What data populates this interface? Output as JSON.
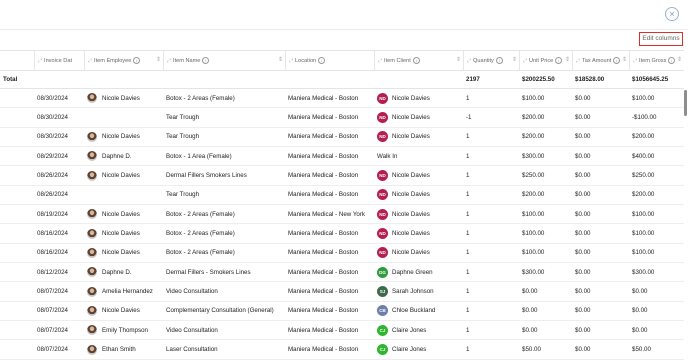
{
  "header": {
    "close_icon": "×",
    "edit_columns_label": "Edit columns"
  },
  "columns": [
    {
      "label": "",
      "sortable": false
    },
    {
      "label": "Invoice Dat",
      "sortable": false
    },
    {
      "label": "Item Employee",
      "sortable": true,
      "info": true
    },
    {
      "label": "Item Name",
      "sortable": true,
      "info": true
    },
    {
      "label": "Location",
      "sortable": false,
      "info": true
    },
    {
      "label": "Item Client",
      "sortable": true,
      "info": true
    },
    {
      "label": "Quantity",
      "sortable": true,
      "info": true
    },
    {
      "label": "Unit Price",
      "sortable": true,
      "info": true
    },
    {
      "label": "Tax Amount",
      "sortable": true,
      "info": true
    },
    {
      "label": "Item Gross",
      "sortable": true,
      "info": true
    }
  ],
  "total_row": {
    "label": "Total",
    "quantity": "2197",
    "unit_price": "$200225.50",
    "tax_amount": "$18528.00",
    "item_gross": "$1056645.25"
  },
  "rows": [
    {
      "date": "08/30/2024",
      "employee": "Nicole Davies",
      "employee_avatar": true,
      "item": "Botox - 2 Areas (Female)",
      "location": "Maniera Medical - Boston",
      "client": "Nicole Davies",
      "client_initials": "ND",
      "client_color": "#b51f4f",
      "qty": "1",
      "unit": "$100.00",
      "tax": "$0.00",
      "gross": "$100.00"
    },
    {
      "date": "08/30/2024",
      "employee": "",
      "employee_avatar": false,
      "item": "Tear Trough",
      "location": "Maniera Medical - Boston",
      "client": "Nicole Davies",
      "client_initials": "ND",
      "client_color": "#b51f4f",
      "qty": "-1",
      "unit": "$200.00",
      "tax": "$0.00",
      "gross": "-$100.00"
    },
    {
      "date": "08/30/2024",
      "employee": "Nicole Davies",
      "employee_avatar": true,
      "item": "Tear Trough",
      "location": "Maniera Medical - Boston",
      "client": "Nicole Davies",
      "client_initials": "ND",
      "client_color": "#b51f4f",
      "qty": "1",
      "unit": "$200.00",
      "tax": "$0.00",
      "gross": "$200.00"
    },
    {
      "date": "08/29/2024",
      "employee": "Daphne D.",
      "employee_avatar": true,
      "item": "Botox - 1 Area (Female)",
      "location": "Maniera Medical - Boston",
      "client": "Walk In",
      "client_initials": "",
      "client_color": "",
      "qty": "1",
      "unit": "$300.00",
      "tax": "$0.00",
      "gross": "$400.00"
    },
    {
      "date": "08/26/2024",
      "employee": "Nicole Davies",
      "employee_avatar": true,
      "item": "Dermal Fillers Smokers Lines",
      "location": "Maniera Medical - Boston",
      "client": "Nicole Davies",
      "client_initials": "ND",
      "client_color": "#b51f4f",
      "qty": "1",
      "unit": "$250.00",
      "tax": "$0.00",
      "gross": "$250.00"
    },
    {
      "date": "08/26/2024",
      "employee": "",
      "employee_avatar": false,
      "item": "Tear Trough",
      "location": "Maniera Medical - Boston",
      "client": "Nicole Davies",
      "client_initials": "ND",
      "client_color": "#b51f4f",
      "qty": "1",
      "unit": "$200.00",
      "tax": "$0.00",
      "gross": "$200.00"
    },
    {
      "date": "08/19/2024",
      "employee": "Nicole Davies",
      "employee_avatar": true,
      "item": "Botox - 2 Areas (Female)",
      "location": "Maniera Medical - New York",
      "client": "Nicole Davies",
      "client_initials": "ND",
      "client_color": "#b51f4f",
      "qty": "1",
      "unit": "$100.00",
      "tax": "$0.00",
      "gross": "$100.00"
    },
    {
      "date": "08/16/2024",
      "employee": "Nicole Davies",
      "employee_avatar": true,
      "item": "Botox - 2 Areas (Female)",
      "location": "Maniera Medical - Boston",
      "client": "Nicole Davies",
      "client_initials": "ND",
      "client_color": "#b51f4f",
      "qty": "1",
      "unit": "$100.00",
      "tax": "$0.00",
      "gross": "$100.00"
    },
    {
      "date": "08/16/2024",
      "employee": "Nicole Davies",
      "employee_avatar": true,
      "item": "Botox - 2 Areas (Female)",
      "location": "Maniera Medical - Boston",
      "client": "Nicole Davies",
      "client_initials": "ND",
      "client_color": "#b51f4f",
      "qty": "1",
      "unit": "$100.00",
      "tax": "$0.00",
      "gross": "$100.00"
    },
    {
      "date": "08/12/2024",
      "employee": "Daphne D.",
      "employee_avatar": true,
      "item": "Dermal Fillers - Smokers Lines",
      "location": "Maniera Medical - Boston",
      "client": "Daphne Green",
      "client_initials": "DG",
      "client_color": "#2e9b3f",
      "qty": "1",
      "unit": "$300.00",
      "tax": "$0.00",
      "gross": "$300.00"
    },
    {
      "date": "08/07/2024",
      "employee": "Amelia Hernandez",
      "employee_avatar": true,
      "item": "Video Consultation",
      "location": "Maniera Medical - Boston",
      "client": "Sarah Johnson",
      "client_initials": "SJ",
      "client_color": "#3f6b4d",
      "qty": "1",
      "unit": "$0.00",
      "tax": "$0.00",
      "gross": "$0.00"
    },
    {
      "date": "08/07/2024",
      "employee": "Nicole Davies",
      "employee_avatar": true,
      "item": "Complementary Consultation (General)",
      "location": "Maniera Medical - Boston",
      "client": "Chloe Buckland",
      "client_initials": "CB",
      "client_color": "#6b7fa8",
      "qty": "1",
      "unit": "$0.00",
      "tax": "$0.00",
      "gross": "$0.00"
    },
    {
      "date": "08/07/2024",
      "employee": "Emily Thompson",
      "employee_avatar": true,
      "item": "Video Consultation",
      "location": "Maniera Medical - Boston",
      "client": "Claire Jones",
      "client_initials": "CJ",
      "client_color": "#2fb52f",
      "qty": "1",
      "unit": "$0.00",
      "tax": "$0.00",
      "gross": "$0.00"
    },
    {
      "date": "08/07/2024",
      "employee": "Ethan Smith",
      "employee_avatar": true,
      "item": "Laser Consultation",
      "location": "Maniera Medical - Boston",
      "client": "Claire Jones",
      "client_initials": "CJ",
      "client_color": "#2fb52f",
      "qty": "1",
      "unit": "$50.00",
      "tax": "$0.00",
      "gross": "$50.00"
    }
  ]
}
